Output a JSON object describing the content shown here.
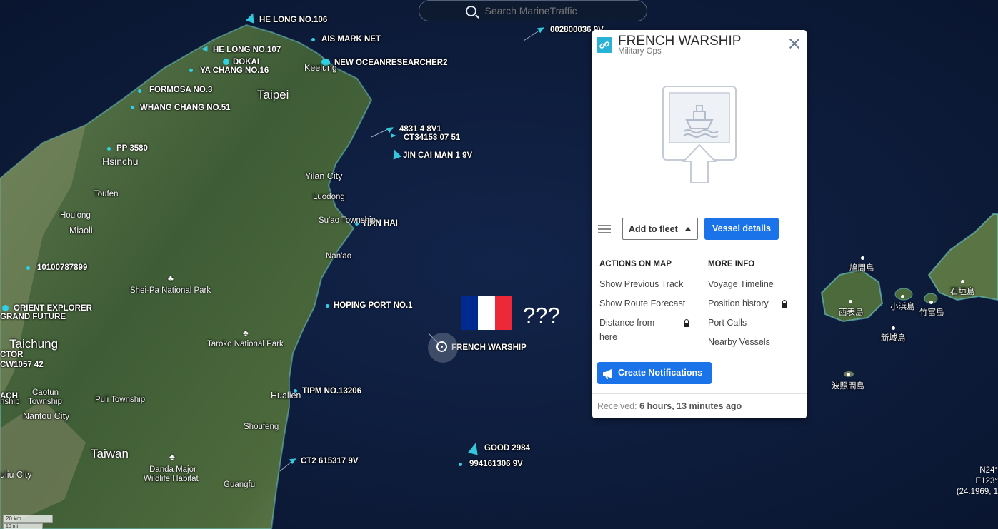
{
  "search": {
    "placeholder": "Search MarineTraffic"
  },
  "vessels": [
    "HE LONG NO.106",
    "AIS MARK NET",
    "002800036 9V",
    "HE LONG NO.107",
    "DOKAI",
    "NEW OCEANRESEARCHER2",
    "YA CHANG NO.16",
    "FORMOSA NO.3",
    "WHANG CHANG NO.51",
    "4831 4 8V1",
    "CT34153 07 51",
    "JIN CAI MAN 1 9V",
    "PP 3580",
    "TIAN HAI",
    "10100787899",
    "HOPING PORT NO.1",
    "ORIENT EXPLORER",
    "GRAND FUTURE",
    "FRENCH WARSHIP",
    "CTOR",
    "CW1057 42",
    "TIPM NO.13206",
    "ACH",
    "GOOD 2984",
    "CT2 615317 9V",
    "994161306 9V"
  ],
  "places": [
    "Keelung",
    "Taipei",
    "Hsinchu",
    "Yilan City",
    "Luodong",
    "Toufen",
    "Su'ao Township",
    "Houlong",
    "Miaoli",
    "Nan'ao",
    "Shei-Pa National Park",
    "Taroko National Park",
    "Taichung",
    "Caotun",
    "Township",
    "nship",
    "Puli Township",
    "Nantou City",
    "Hualien",
    "Shoufeng",
    "Taiwan",
    "Danda Major",
    "Wildlife Habitat",
    "Guangfu",
    "uliu City",
    "鳩間島",
    "石垣島",
    "西表島",
    "小浜島",
    "竹富島",
    "新城島",
    "波照間島"
  ],
  "annotation": {
    "marks": "???"
  },
  "flag_colors": [
    "#002a8f",
    "#ffffff",
    "#ed2939"
  ],
  "coords": {
    "lat": "N24°",
    "lon": "E123°",
    "decimal": "(24.1969, 1"
  },
  "scale": {
    "km": "20 km",
    "mi": "10 mi"
  },
  "popup": {
    "title": "FRENCH WARSHIP",
    "subtitle": "Military Ops",
    "add_to_fleet": "Add to fleet",
    "vessel_details": "Vessel details",
    "actions_heading": "ACTIONS ON MAP",
    "actions": [
      "Show Previous Track",
      "Show Route Forecast",
      "Distance from",
      "here"
    ],
    "more_heading": "MORE INFO",
    "more": [
      "Voyage Timeline",
      "Position history",
      "Port Calls",
      "Nearby Vessels"
    ],
    "notify": "Create Notifications",
    "received_label": "Received:",
    "received_value": "6 hours, 13 minutes ago"
  },
  "colors": {
    "accent": "#1a73e8",
    "vessel_marker": "#35c8dc",
    "ocean": "#0d1b36"
  }
}
